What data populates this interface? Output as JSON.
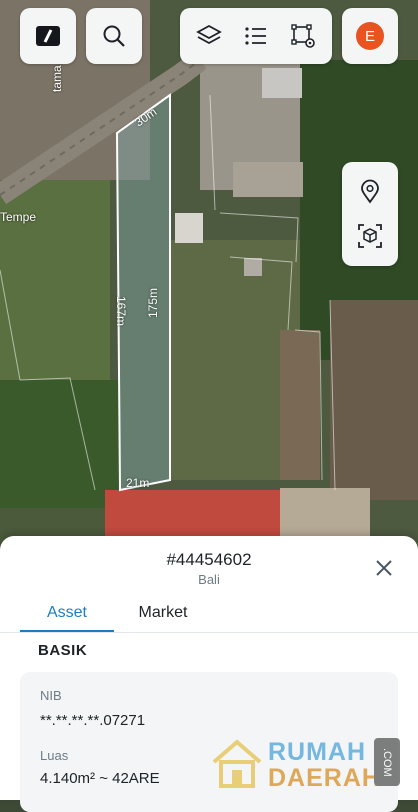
{
  "map": {
    "street_label": "tama",
    "area_label": "Tempe",
    "dimensions": {
      "top": "30m",
      "left": "167m",
      "right": "175m",
      "bottom": "21m"
    }
  },
  "toolbar": {
    "logo_icon": "logo-icon",
    "search_icon": "search-icon",
    "layers_icon": "layers-icon",
    "list_icon": "list-icon",
    "polygon_settings_icon": "polygon-settings-icon",
    "profile_initial": "E",
    "accent_color": "#e8531f"
  },
  "side_controls": {
    "location_icon": "location-pin-icon",
    "view_3d_icon": "cube-scan-icon"
  },
  "sheet": {
    "parcel_id": "#44454602",
    "region": "Bali",
    "close_icon": "close-icon",
    "tabs": [
      {
        "label": "Asset",
        "active": true
      },
      {
        "label": "Market",
        "active": false
      }
    ],
    "section_title": "BASIK",
    "fields": [
      {
        "label": "NIB",
        "value": "**.**.**.**.07271"
      },
      {
        "label": "Luas",
        "value": "4.140m² ~ 42ARE"
      }
    ],
    "active_color": "#1a7fc1"
  },
  "watermark": {
    "line1": "RUMAH",
    "line2": "DAERAH",
    "suffix": ".COM"
  }
}
